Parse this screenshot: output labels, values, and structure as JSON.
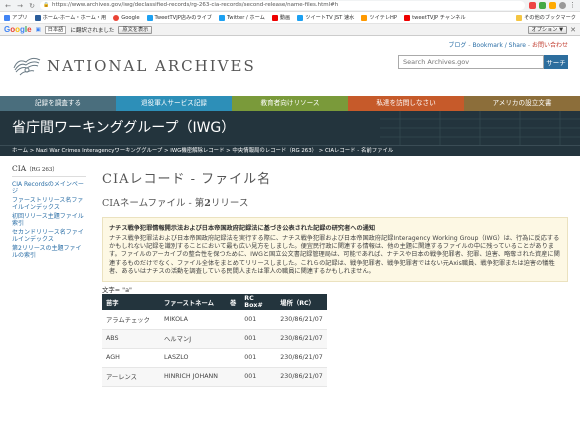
{
  "browser": {
    "url": "https://www.archives.gov/iwg/declassified-records/rg-263-cia-records/second-release/name-files.html#h",
    "bookmarks": [
      "アプリ",
      "ホーム-ホーム・ホーム・用",
      "Google",
      "TweetTVJP店みのライブ",
      "Twitter / ホーム",
      "動画",
      "ツイートTV JST 速水",
      "ツイテレHP",
      "tweetTVJP チャンネル",
      "その他のブックマーク"
    ]
  },
  "translate_bar": {
    "source_lang": "日本語",
    "message": "に翻訳されました",
    "show_original": "原文を表示",
    "options": "オプション ▼"
  },
  "header": {
    "logo": "NATIONAL ARCHIVES",
    "blog": "ブログ",
    "bookmark_share": "Bookmark / Share",
    "contact": "お問い合わせ",
    "search_placeholder": "Search Archives.gov",
    "search_button": "サーチ"
  },
  "nav": [
    {
      "label": "記録を調査する",
      "color": "#4a6e7d"
    },
    {
      "label": "退役軍人サービス記録",
      "color": "#2d8fb8"
    },
    {
      "label": "教育者向けリソース",
      "color": "#7a9a3a"
    },
    {
      "label": "私達を訪問しなさい",
      "color": "#c65a2a"
    },
    {
      "label": "アメリカの設立文書",
      "color": "#8c6e3a"
    }
  ],
  "banner": {
    "title": "省庁間ワーキンググループ（IWG）"
  },
  "breadcrumb": "ホーム > Nazi War Crimes Interagencyワーキンググループ > IWG機密解除レコード > 中央情報局のレコード（RG 263） > CIAレコード - 名前ファイル",
  "sidebar": {
    "heading": "CIA",
    "heading_small": "（RG 263）",
    "links": [
      "CIA Recordsのメインページ",
      "ファーストリリース名ファイルインデックス",
      "初回リリース主題ファイル索引",
      "セカンドリリース名ファイルインデックス",
      "第2リリースの主題ファイルの索引"
    ]
  },
  "main": {
    "title": "CIAレコード - ファイル名",
    "subtitle_pre": "CIAネームファイル - 第",
    "subtitle_bold": "2",
    "subtitle_post": "リリース",
    "notice_title": "ナチス戦争犯罪情報開示法および日本帝国政府記録法に基づき公表された記録の研究者への通知",
    "notice_body": "ナチス戦争犯罪法および日本帝国政府記録法を実行する際に、ナチス戦争犯罪および日本帝国政府記録Interagency Working Group（IWG）は、行為に反応するかもしれない記録を識別することにおいて最も広い見方をしました。便宜民行政に関連する情報は、他の主題に関連するファイルの中に残っていることがあります。ファイルのアーカイブの整合性を保つために、IWGと国立公文書記録管理局は、可能であれば、ナチスや日本の戦争犯罪者、犯罪、迫害、略奪された資産に関連するものだけでなく、ファイル全体をまとめてリリースしました。これらの記録は、戦争犯罪者、戦争犯罪者ではない元Axis職員、戦争犯罪または迫害の犠牲者、あるいはナチスの活動を調査している民間人または軍人の職員に関連するかもしれません。",
    "letter_label": "文字= \"a\"",
    "table": {
      "headers": [
        "苗字",
        "ファーストネーム",
        "巻",
        "RC Box#",
        "場所（RC）"
      ],
      "rows": [
        [
          "アラムチェック",
          "MIKOLA",
          "",
          "001",
          "230/86/21/07"
        ],
        [
          "ABS",
          "ヘルマンJ",
          "",
          "001",
          "230/86/21/07"
        ],
        [
          "AGH",
          "LASZLO",
          "",
          "001",
          "230/86/21/07"
        ],
        [
          "アーレンス",
          "HINRICH JOHANN",
          "",
          "001",
          "230/86/21/07"
        ]
      ]
    }
  }
}
